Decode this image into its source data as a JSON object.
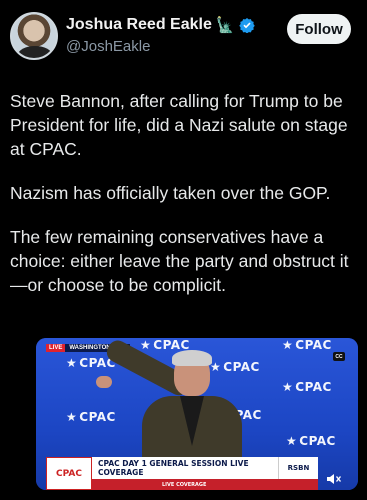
{
  "header": {
    "display_name": "Joshua Reed Eakle",
    "handle": "@JoshEakle",
    "follow_label": "Follow"
  },
  "tweet": {
    "paragraphs": [
      "Steve Bannon, after calling for Trump to be President for life, did a Nazi salute on stage at CPAC.",
      "Nazism has officially taken over the GOP.",
      "The few remaining conservatives have a choice: either leave the party and obstruct it—or choose to be complicit."
    ]
  },
  "media": {
    "live_badge": "LIVE",
    "live_location": "WASHINGTON, D.C.",
    "cc_label": "CC",
    "backdrop_logo": "CPAC",
    "lower_third": {
      "logo": "CPAC",
      "title": "CPAC DAY 1 GENERAL SESSION LIVE COVERAGE",
      "subtitle": "LIVE COVERAGE",
      "network": "RSBN"
    }
  },
  "colors": {
    "background": "#000000",
    "verified": "#1d9bf0",
    "stage_blue": "#1c46c4",
    "lower_third_red": "#c5202a"
  },
  "icons": {
    "statue": "statue-of-liberty-icon",
    "verified": "verified-badge-icon",
    "mute": "speaker-muted-icon"
  }
}
